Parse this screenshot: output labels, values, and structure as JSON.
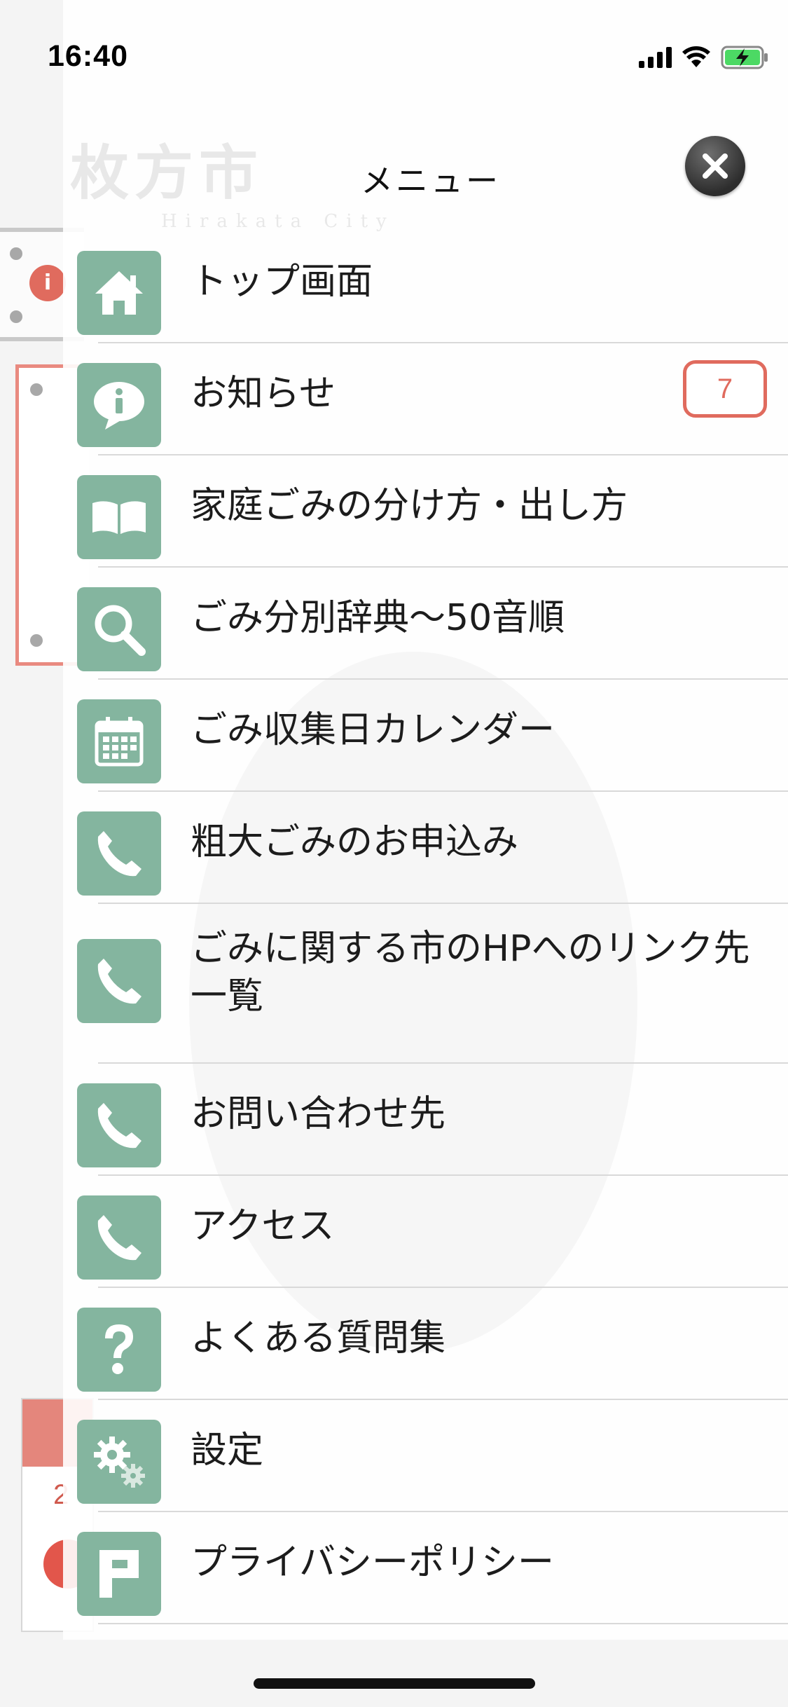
{
  "status_bar": {
    "time": "16:40"
  },
  "background": {
    "notice_badge": "i",
    "calendar_day": "2"
  },
  "watermark": {
    "logo_text": "枚方市",
    "logo_sub": "Hirakata City"
  },
  "menu": {
    "title": "メニュー",
    "items": [
      {
        "label": "トップ画面",
        "icon": "home-icon"
      },
      {
        "label": "お知らせ",
        "icon": "info-speech-icon",
        "badge": "7"
      },
      {
        "label": "家庭ごみの分け方・出し方",
        "icon": "book-icon"
      },
      {
        "label": "ごみ分別辞典〜50音順",
        "icon": "search-icon"
      },
      {
        "label": "ごみ収集日カレンダー",
        "icon": "calendar-icon"
      },
      {
        "label": "粗大ごみのお申込み",
        "icon": "phone-icon"
      },
      {
        "label": "ごみに関する市のHPへのリンク先一覧",
        "icon": "phone-icon"
      },
      {
        "label": "お問い合わせ先",
        "icon": "phone-icon"
      },
      {
        "label": "アクセス",
        "icon": "phone-icon"
      },
      {
        "label": "よくある質問集",
        "icon": "question-icon"
      },
      {
        "label": "設定",
        "icon": "gear-icon"
      },
      {
        "label": "プライバシーポリシー",
        "icon": "parking-p-icon"
      }
    ]
  },
  "colors": {
    "icon_bg": "#84b59f",
    "badge": "#e06b5e"
  }
}
